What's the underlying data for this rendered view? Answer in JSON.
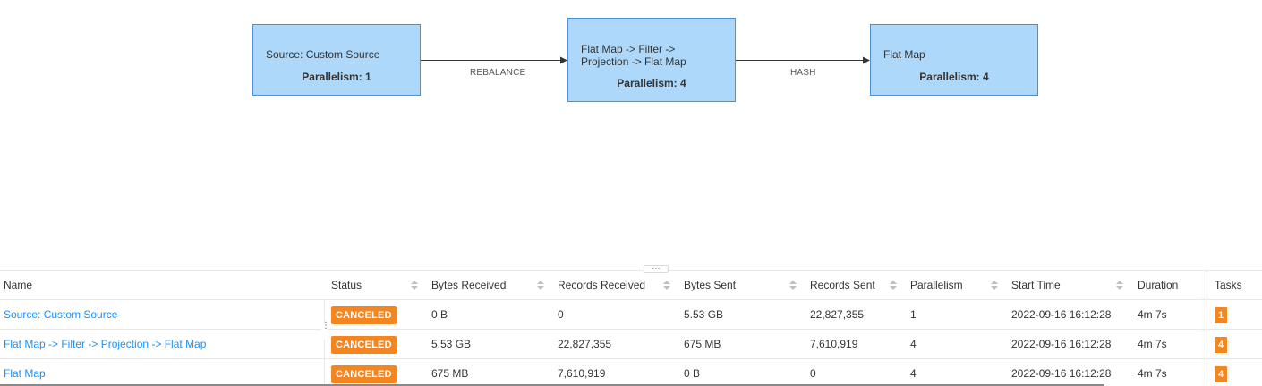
{
  "dag": {
    "nodes": [
      {
        "title": "Source: Custom Source",
        "parallelism": "Parallelism: 1"
      },
      {
        "title": "Flat Map -> Filter -> Projection -> Flat Map",
        "parallelism": "Parallelism: 4"
      },
      {
        "title": "Flat Map",
        "parallelism": "Parallelism: 4"
      }
    ],
    "edges": [
      {
        "label": "REBALANCE"
      },
      {
        "label": "HASH"
      }
    ]
  },
  "resizer": {
    "label": "···"
  },
  "table": {
    "headers": {
      "name": "Name",
      "status": "Status",
      "bytes_received": "Bytes Received",
      "records_received": "Records Received",
      "bytes_sent": "Bytes Sent",
      "records_sent": "Records Sent",
      "parallelism": "Parallelism",
      "start_time": "Start Time",
      "duration": "Duration",
      "tasks": "Tasks"
    },
    "rows": [
      {
        "name": "Source: Custom Source",
        "status": "CANCELED",
        "bytes_received": "0 B",
        "records_received": "0",
        "bytes_sent": "5.53 GB",
        "records_sent": "22,827,355",
        "parallelism": "1",
        "start_time": "2022-09-16 16:12:28",
        "duration": "4m 7s",
        "tasks": "1"
      },
      {
        "name": "Flat Map -> Filter -> Projection -> Flat Map",
        "status": "CANCELED",
        "bytes_received": "5.53 GB",
        "records_received": "22,827,355",
        "bytes_sent": "675 MB",
        "records_sent": "7,610,919",
        "parallelism": "4",
        "start_time": "2022-09-16 16:12:28",
        "duration": "4m 7s",
        "tasks": "4"
      },
      {
        "name": "Flat Map",
        "status": "CANCELED",
        "bytes_received": "675 MB",
        "records_received": "7,610,919",
        "bytes_sent": "0 B",
        "records_sent": "0",
        "parallelism": "4",
        "start_time": "2022-09-16 16:12:28",
        "duration": "4m 7s",
        "tasks": "4"
      }
    ]
  },
  "colors": {
    "node_fill": "#add8f9",
    "node_border": "#4a90d9",
    "status_canceled": "#f5861f",
    "link": "#1890ff"
  }
}
